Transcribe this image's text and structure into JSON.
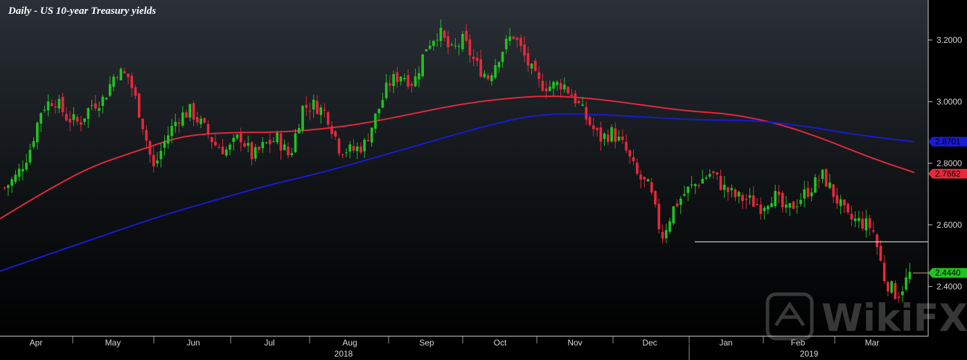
{
  "chart_data": {
    "type": "line",
    "title": "Daily - US 10-year Treasury yields",
    "y_ticks": [
      "3.2000",
      "3.0000",
      "2.8000",
      "2.6000",
      "2.4000"
    ],
    "y_tick_values": [
      3.2,
      3.0,
      2.8,
      2.6,
      2.4
    ],
    "ylim": [
      2.24,
      3.33
    ],
    "month_labels": [
      "Apr",
      "May",
      "Jun",
      "Jul",
      "Aug",
      "Sep",
      "Oct",
      "Nov",
      "Dec",
      "Jan",
      "Feb",
      "Mar"
    ],
    "year_labels": [
      "2018",
      "2019"
    ],
    "grid": false,
    "series": [
      {
        "name": "",
        "kind": "candlestick",
        "color_up": "#22c222",
        "color_down": "#e8283c",
        "close_values": [
          2.72,
          2.76,
          2.84,
          2.98,
          3.01,
          2.95,
          2.93,
          2.99,
          3.01,
          3.1,
          3.08,
          2.95,
          2.78,
          2.88,
          2.95,
          2.97,
          2.92,
          2.86,
          2.84,
          2.89,
          2.82,
          2.86,
          2.88,
          2.82,
          2.98,
          2.99,
          2.96,
          2.85,
          2.84,
          2.86,
          2.96,
          3.06,
          3.09,
          3.06,
          3.18,
          3.23,
          3.16,
          3.2,
          3.12,
          3.08,
          3.16,
          3.22,
          3.14,
          3.06,
          3.05,
          3.06,
          3.01,
          2.94,
          2.88,
          2.9,
          2.85,
          2.76,
          2.72,
          2.56,
          2.66,
          2.71,
          2.74,
          2.77,
          2.72,
          2.69,
          2.68,
          2.66,
          2.7,
          2.64,
          2.68,
          2.72,
          2.76,
          2.69,
          2.62,
          2.61,
          2.59,
          2.42,
          2.37,
          2.44
        ]
      },
      {
        "name": "",
        "kind": "moving-average",
        "color": "#e8283c",
        "last_value": "2.7662",
        "values": [
          2.62,
          2.71,
          2.79,
          2.84,
          2.89,
          2.9,
          2.9,
          2.91,
          2.93,
          2.96,
          2.99,
          3.01,
          3.02,
          3.01,
          2.99,
          2.97,
          2.96,
          2.93,
          2.88,
          2.82,
          2.77
        ]
      },
      {
        "name": "",
        "kind": "moving-average",
        "color": "#1a1ad8",
        "last_value": "2.8701",
        "values": [
          2.45,
          2.51,
          2.57,
          2.63,
          2.68,
          2.73,
          2.77,
          2.82,
          2.87,
          2.92,
          2.96,
          2.96,
          2.95,
          2.94,
          2.94,
          2.92,
          2.89,
          2.87
        ]
      }
    ],
    "current_value": "2.4440",
    "current_value_color": "#22c222",
    "support_line": {
      "value": 2.545,
      "color": "#ffffff"
    },
    "watermark": "WikiFX"
  }
}
